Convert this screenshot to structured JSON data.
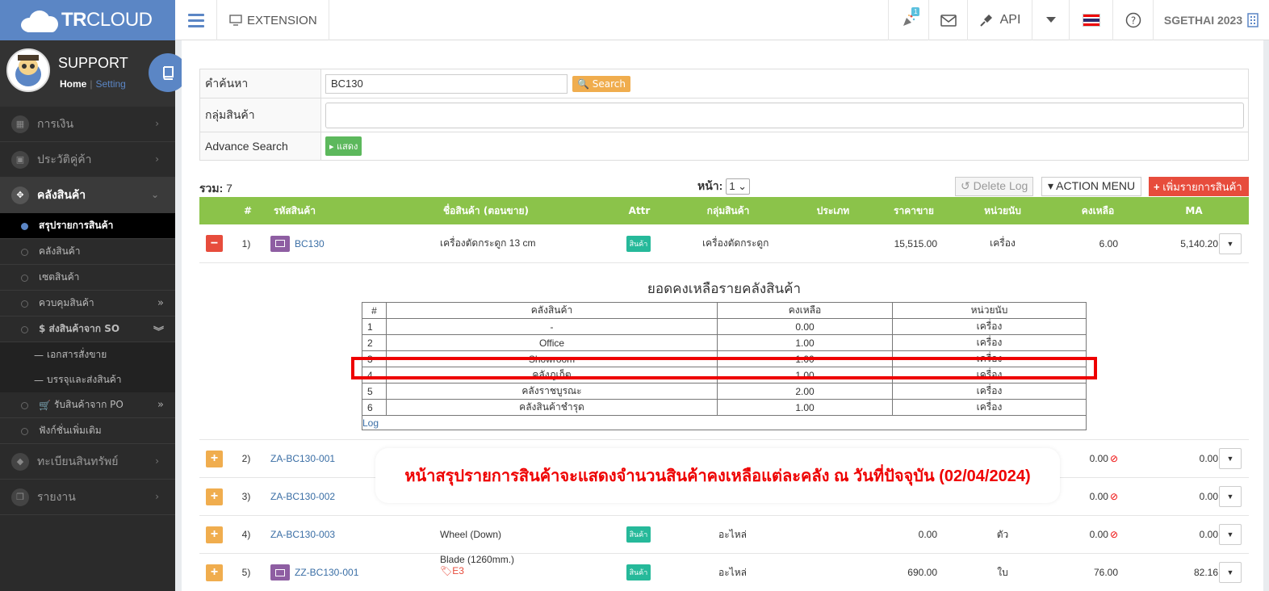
{
  "app": {
    "logo_bold": "TR",
    "logo_rest": "CLOUD",
    "extension": "EXTENSION",
    "notif_count": "1",
    "api_label": "API",
    "user": "SGETHAI 2023"
  },
  "profile": {
    "name": "SUPPORT",
    "home": "Home",
    "sep": "|",
    "setting": "Setting"
  },
  "sidebar": {
    "items": [
      {
        "label": "การเงิน"
      },
      {
        "label": "ประวัติคู่ค้า"
      },
      {
        "label": "คลังสินค้า"
      },
      {
        "label": "ทะเบียนสินทรัพย์"
      },
      {
        "label": "รายงาน"
      }
    ],
    "subs": [
      {
        "label": "สรุปรายการสินค้า"
      },
      {
        "label": "คลังสินค้า"
      },
      {
        "label": "เซตสินค้า"
      },
      {
        "label": "ควบคุมสินค้า"
      },
      {
        "label": "$ ส่งสินค้าจาก SO"
      },
      {
        "label": "รับสินค้าจาก PO"
      },
      {
        "label": "ฟังก์ชั่นเพิ่มเติม"
      }
    ],
    "subsubs": [
      {
        "label": "เอกสารสั่งขาย"
      },
      {
        "label": "บรรจุและส่งสินค้า"
      }
    ]
  },
  "form": {
    "search_label": "คำค้นหา",
    "search_value": "BC130",
    "search_btn": "Search",
    "group_label": "กลุ่มสินค้า",
    "group_value": "",
    "adv_label": "Advance Search",
    "show_btn": "แสดง"
  },
  "summary": {
    "total_label": "รวม:",
    "total_value": "7",
    "page_label": "หน้า:",
    "page_value": "1",
    "delete_log": "Delete Log",
    "action_menu": "ACTION MENU",
    "add_item": "เพิ่มรายการสินค้า"
  },
  "table": {
    "headers": [
      "#",
      "รหัสสินค้า",
      "ชื่อสินค้า (ตอนขาย)",
      "Attr",
      "กลุ่มสินค้า",
      "ประเภท",
      "ราคาขาย",
      "หน่วยนับ",
      "คงเหลือ",
      "MA"
    ],
    "rows": [
      {
        "no": "1)",
        "code": "BC130",
        "name": "เครื่องตัดกระดูก 13 cm",
        "attr": "สินค้า",
        "group": "เครื่องตัดกระดูก",
        "price": "15,515.00",
        "unit": "เครื่อง",
        "stock": "6.00",
        "ma": "5,140.20"
      },
      {
        "no": "2)",
        "code": "ZA-BC130-001",
        "name": "",
        "attr": "",
        "group": "",
        "price": "",
        "unit": "",
        "stock": "0.00",
        "ma": "0.00"
      },
      {
        "no": "3)",
        "code": "ZA-BC130-002",
        "name": "",
        "attr": "",
        "group": "",
        "price": "",
        "unit": "",
        "stock": "0.00",
        "ma": "0.00"
      },
      {
        "no": "4)",
        "code": "ZA-BC130-003",
        "name": "Wheel (Down)",
        "attr": "สินค้า",
        "group": "อะไหล่",
        "price": "0.00",
        "unit": "ตัว",
        "stock": "0.00",
        "ma": "0.00"
      },
      {
        "no": "5)",
        "code": "ZZ-BC130-001",
        "name": "Blade (1260mm.)",
        "tag": "E3",
        "attr": "สินค้า",
        "group": "อะไหล่",
        "price": "690.00",
        "unit": "ใบ",
        "stock": "76.00",
        "ma": "82.16"
      }
    ]
  },
  "detail": {
    "title": "ยอดคงเหลือรายคลังสินค้า",
    "headers": [
      "#",
      "คลังสินค้า",
      "คงเหลือ",
      "หน่วยนับ"
    ],
    "rows": [
      {
        "no": "1",
        "wh": "-",
        "qty": "0.00",
        "unit": "เครื่อง"
      },
      {
        "no": "2",
        "wh": "Office",
        "qty": "1.00",
        "unit": "เครื่อง"
      },
      {
        "no": "3",
        "wh": "Showroom",
        "qty": "1.00",
        "unit": "เครื่อง"
      },
      {
        "no": "4",
        "wh": "คลังภูเก็ต",
        "qty": "1.00",
        "unit": "เครื่อง"
      },
      {
        "no": "5",
        "wh": "คลังราชบูรณะ",
        "qty": "2.00",
        "unit": "เครื่อง"
      },
      {
        "no": "6",
        "wh": "คลังสินค้าชำรุด",
        "qty": "1.00",
        "unit": "เครื่อง"
      }
    ],
    "log": "Log"
  },
  "overlay": {
    "text": "หน้าสรุปรายการสินค้าจะแสดงจำนวนสินค้าคงเหลือแต่ละคลัง ณ วันที่ปัจจุบัน (02/04/2024)"
  },
  "colors": {
    "brand": "#5b86c5",
    "header_green": "#8bc34a",
    "danger": "#e74c3c",
    "warning": "#f0ad4e",
    "attr_teal": "#26b99a"
  }
}
